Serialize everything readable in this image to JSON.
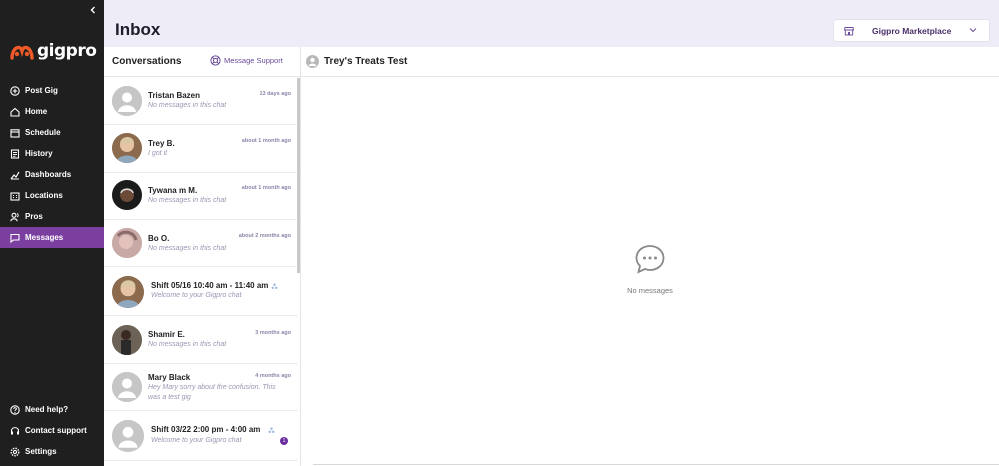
{
  "sidebar": {
    "logo_text": "gigpro",
    "collapse_icon": "chevron-left-icon",
    "nav": [
      {
        "label": "Post Gig",
        "icon": "plus-circle-icon"
      },
      {
        "label": "Home",
        "icon": "home-icon"
      },
      {
        "label": "Schedule",
        "icon": "calendar-icon"
      },
      {
        "label": "History",
        "icon": "history-icon"
      },
      {
        "label": "Dashboards",
        "icon": "chart-icon"
      },
      {
        "label": "Locations",
        "icon": "building-icon"
      },
      {
        "label": "Pros",
        "icon": "users-icon"
      },
      {
        "label": "Messages",
        "icon": "message-icon",
        "active": true
      }
    ],
    "footer": [
      {
        "label": "Need help?",
        "icon": "help-icon"
      },
      {
        "label": "Contact support",
        "icon": "headset-icon"
      },
      {
        "label": "Settings",
        "icon": "gear-icon"
      }
    ]
  },
  "header": {
    "title": "Inbox",
    "marketplace_select": "Gigpro Marketplace"
  },
  "conversations": {
    "title": "Conversations",
    "support_link": "Message Support",
    "items": [
      {
        "name": "Tristan Bazen",
        "time": "13 days ago",
        "preview": "No messages in this chat",
        "avatar": "default"
      },
      {
        "name": "Trey B.",
        "time": "about 1 month ago",
        "preview": "I got it",
        "avatar": "photo"
      },
      {
        "name": "Tywana m M.",
        "time": "about 1 month ago",
        "preview": "No messages in this chat",
        "avatar": "photo"
      },
      {
        "name": "Bo O.",
        "time": "about 2 months ago",
        "preview": "No messages in this chat",
        "avatar": "photo"
      },
      {
        "name": "Shift 05/16 10:40 am - 11:40 am",
        "time": "",
        "preview": "Welcome to your Gigpro chat",
        "avatar": "photo",
        "group": true
      },
      {
        "name": "Shamir E.",
        "time": "3 months ago",
        "preview": "No messages in this chat",
        "avatar": "photo"
      },
      {
        "name": "Mary Black",
        "time": "4 months ago",
        "preview": "Hey Mary sorry about the confusion. This was a test gig",
        "avatar": "default"
      },
      {
        "name": "Shift 03/22 2:00 pm - 4:00 am",
        "time": "",
        "preview": "Welcome to your Gigpro chat",
        "avatar": "default",
        "group": true,
        "unread": "1"
      }
    ]
  },
  "chat": {
    "title": "Trey's Treats Test",
    "empty_text": "No messages"
  },
  "colors": {
    "sidebar_bg": "#1f1f1f",
    "active_nav": "#7b3fa0",
    "header_bg": "#eeecf7",
    "logo_accent": "#f05a28"
  }
}
